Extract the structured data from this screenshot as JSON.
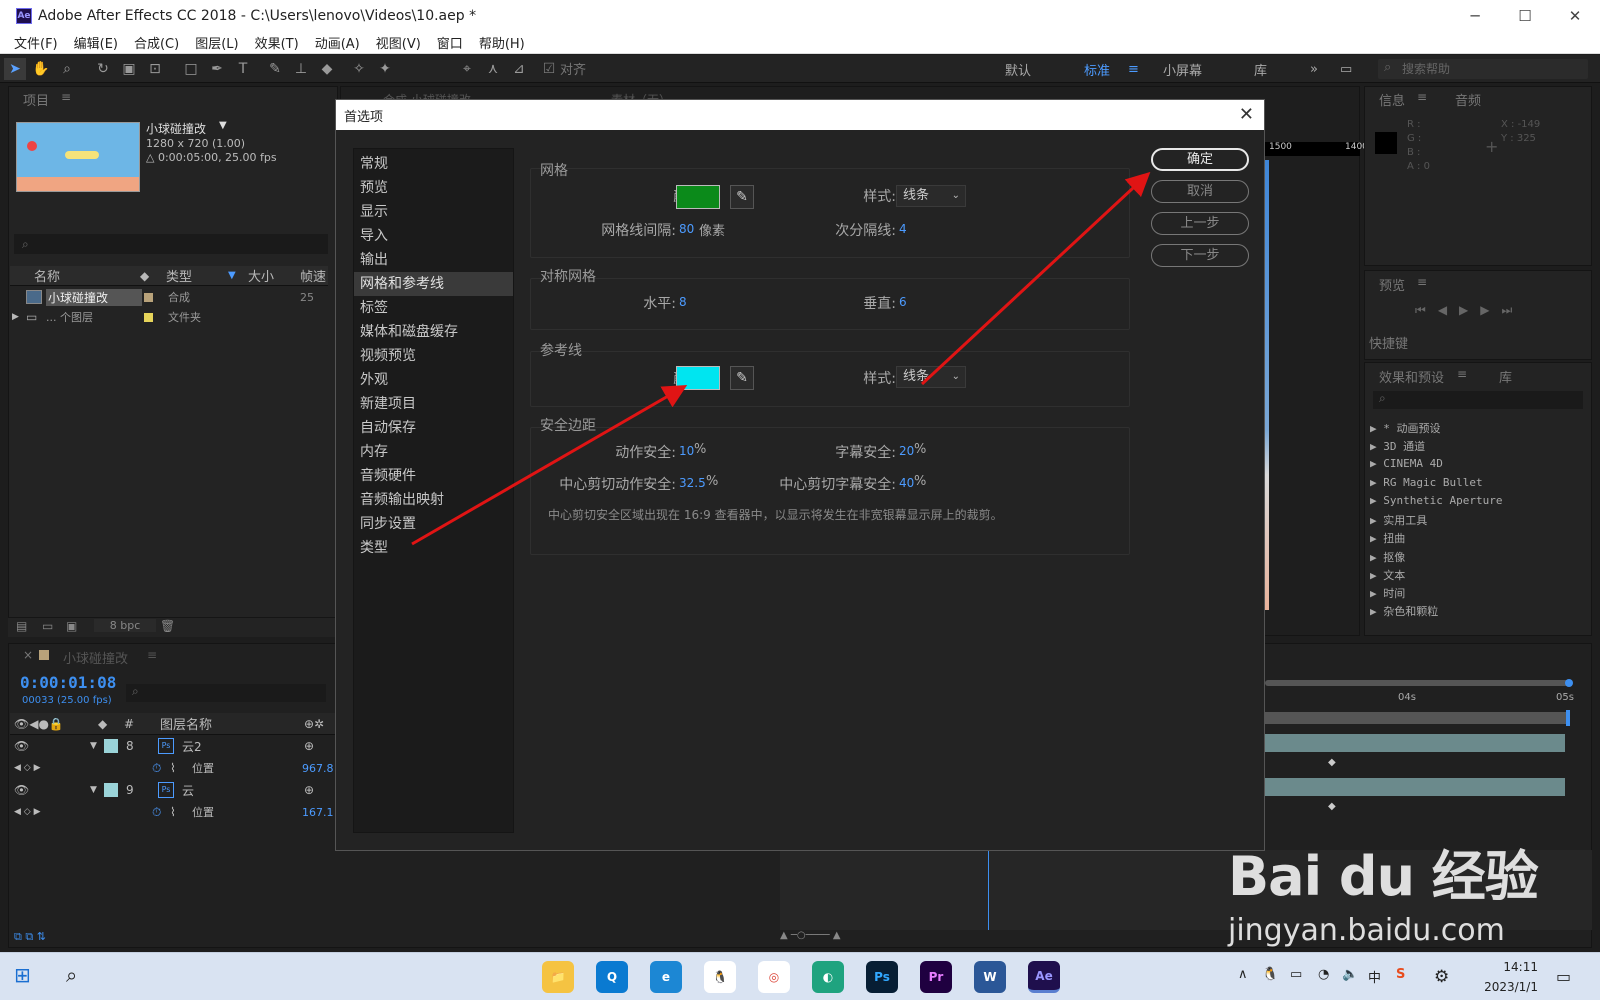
{
  "window": {
    "title": "Adobe After Effects CC 2018 - C:\\Users\\lenovo\\Videos\\10.aep *",
    "logo": "Ae",
    "controls": [
      "─",
      "☐",
      "✕"
    ]
  },
  "menubar": [
    "文件(F)",
    "编辑(E)",
    "合成(C)",
    "图层(L)",
    "效果(T)",
    "动画(A)",
    "视图(V)",
    "窗口",
    "帮助(H)"
  ],
  "toolbar": {
    "align_label": "对齐",
    "workspaces": [
      "默认",
      "标准",
      "小屏幕",
      "库"
    ],
    "overflow": "»",
    "search_placeholder": "搜索帮助"
  },
  "project": {
    "title": "项目",
    "comp_name": "小球碰撞改",
    "comp_size": "1280 x 720 (1.00)",
    "comp_duration": "△ 0:00:05:00, 25.00 fps",
    "columns": [
      "名称",
      "类型",
      "大小",
      "帧速"
    ],
    "rows": [
      {
        "name": "小球碰撞改",
        "type": "合成",
        "fps": "25",
        "color": "#b8a27a"
      },
      {
        "name": "... 个图层",
        "type": "文件夹",
        "fps": "",
        "color": "#e6d45a"
      }
    ],
    "bpc": "8 bpc"
  },
  "comp_tabs": {
    "comp": "合成 小球碰撞改",
    "footage": "素材（无）"
  },
  "dialog": {
    "title": "首选项",
    "close": "✕",
    "nav": [
      "常规",
      "预览",
      "显示",
      "导入",
      "输出",
      "网格和参考线",
      "标签",
      "媒体和磁盘缓存",
      "视频预览",
      "外观",
      "新建项目",
      "自动保存",
      "内存",
      "音频硬件",
      "音频输出映射",
      "同步设置",
      "类型"
    ],
    "selected_nav": "网格和参考线",
    "grid": {
      "label": "网格",
      "color_label": "颜色:",
      "color": "#0b8a1a",
      "style_label": "样式:",
      "style_value": "线条",
      "spacing_label": "网格线间隔:",
      "spacing_value": "80",
      "spacing_unit": "像素",
      "subdiv_label": "次分隔线:",
      "subdiv_value": "4"
    },
    "proportional_grid": {
      "label": "对称网格",
      "horizontal_label": "水平:",
      "horizontal_value": "8",
      "vertical_label": "垂直:",
      "vertical_value": "6"
    },
    "guides": {
      "label": "参考线",
      "color_label": "颜色:",
      "color": "#00e5f0",
      "style_label": "样式:",
      "style_value": "线条"
    },
    "safe_margins": {
      "label": "安全边距",
      "action_label": "动作安全:",
      "action_value": "10",
      "title_label": "字幕安全:",
      "title_value": "20",
      "cc_action_label": "中心剪切动作安全:",
      "cc_action_value": "32.5",
      "cc_title_label": "中心剪切字幕安全:",
      "cc_title_value": "40",
      "percent": "%",
      "note": "中心剪切安全区域出现在 16:9 查看器中，以显示将发生在非宽银幕显示屏上的裁剪。"
    },
    "buttons": {
      "ok": "确定",
      "cancel": "取消",
      "prev": "上一步",
      "next": "下一步"
    }
  },
  "info_panel": {
    "tabs": [
      "信息",
      "音频"
    ],
    "channels": [
      "R :",
      "G :",
      "B :",
      "A : 0"
    ],
    "coords": [
      "X : -149",
      "Y : 325"
    ]
  },
  "preview_panel": {
    "title": "预览",
    "shortcut": "快捷键"
  },
  "effects_panel": {
    "tabs": [
      "效果和预设",
      "库"
    ],
    "items": [
      "* 动画预设",
      "3D 通道",
      "CINEMA 4D",
      "RG Magic Bullet",
      "Synthetic Aperture",
      "实用工具",
      "扭曲",
      "抠像",
      "文本",
      "时间",
      "杂色和颗粒"
    ]
  },
  "timeline": {
    "tab": "小球碰撞改",
    "timecode": "0:00:01:08",
    "frame_info": "00033 (25.00 fps)",
    "col_label": "图层名称",
    "hash": "#",
    "ruler": [
      "04s",
      "05s"
    ],
    "ruler_extra": [
      "1500",
      "1400"
    ],
    "layers": [
      {
        "num": "8",
        "name": "云2",
        "prop": "位置",
        "prop_value": "967.8"
      },
      {
        "num": "9",
        "name": "云",
        "prop": "位置",
        "prop_value": "167.1"
      }
    ]
  },
  "taskbar": {
    "apps": [
      "📁",
      "Q",
      "e",
      "🐧",
      "◎",
      "◐",
      "Ps",
      "Pr",
      "W",
      "Ae"
    ],
    "tray": [
      "∧",
      "中",
      "S"
    ],
    "time": "14:11",
    "date": "2023/1/1"
  },
  "watermark": {
    "brand": "Bai du 经验",
    "url": "jingyan.baidu.com"
  }
}
